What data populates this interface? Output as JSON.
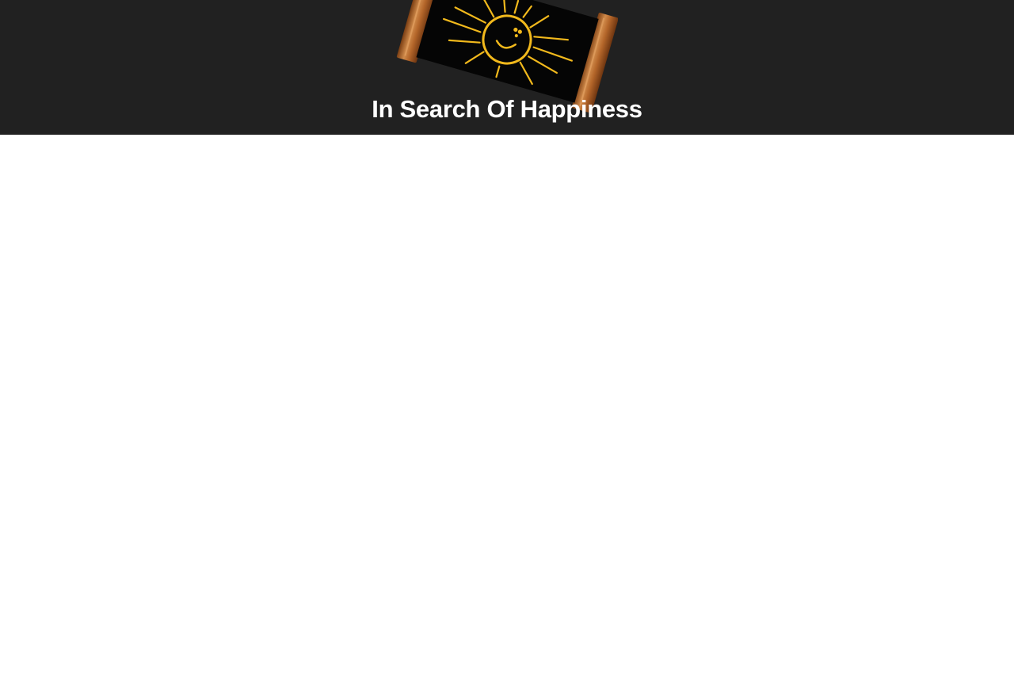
{
  "site": {
    "title": "In Search Of Happiness",
    "logo_icon": "smiling-sun-sign-icon"
  },
  "colors": {
    "header_background": "#212121",
    "title_text": "#ffffff",
    "sun_yellow": "#f2b91c",
    "sign_board": "#050505",
    "wood_post": "#b4662a",
    "page_background": "#ffffff"
  }
}
